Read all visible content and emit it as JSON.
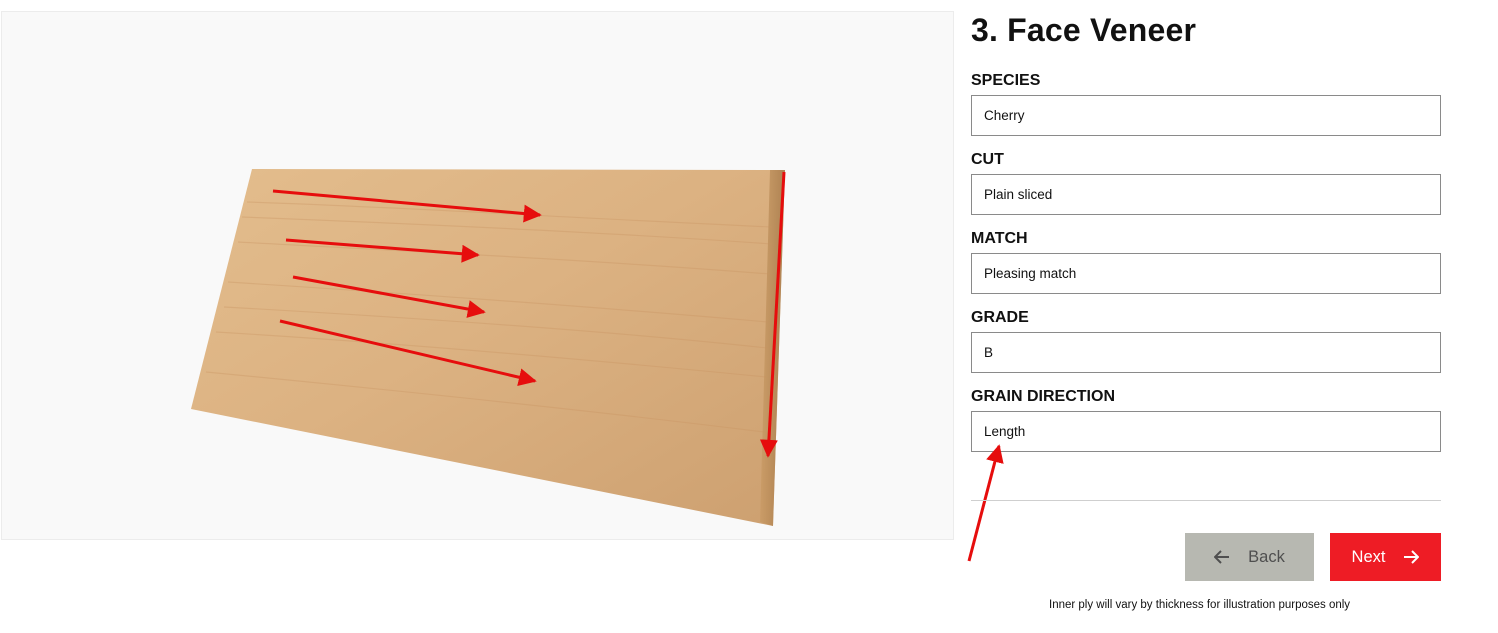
{
  "title": "3. Face Veneer",
  "fields": [
    {
      "label": "SPECIES",
      "value": "Cherry"
    },
    {
      "label": "CUT",
      "value": "Plain sliced"
    },
    {
      "label": "MATCH",
      "value": "Pleasing match"
    },
    {
      "label": "GRADE",
      "value": "B"
    },
    {
      "label": "GRAIN DIRECTION",
      "value": "Length"
    }
  ],
  "buttons": {
    "back_label": "Back",
    "next_label": "Next"
  },
  "note": "Inner ply will vary by thickness for illustration purposes only",
  "colors": {
    "accent": "#ee1c25",
    "back_button": "#b7b8b1",
    "annotation_arrow": "#e60d0d"
  }
}
